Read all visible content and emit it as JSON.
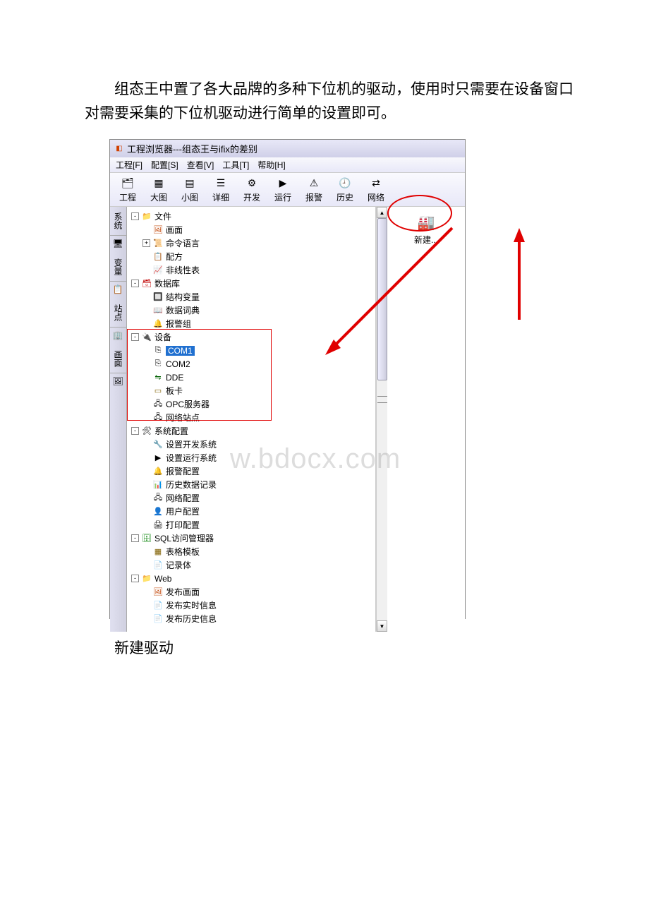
{
  "doc": {
    "intro": "组态王中置了各大品牌的多种下位机的驱动，使用时只需要在设备窗口对需要采集的下位机驱动进行简单的设置即可。",
    "caption": "新建驱动"
  },
  "window": {
    "title": "工程浏览器---组态王与ifix的差别"
  },
  "menu": {
    "project": "工程[F]",
    "config": "配置[S]",
    "view": "查看[V]",
    "tools": "工具[T]",
    "help": "帮助[H]"
  },
  "toolbar": {
    "project": "工程",
    "bigicon": "大图",
    "smallicon": "小图",
    "detail": "详细",
    "develop": "开发",
    "run": "运行",
    "alarm": "报警",
    "history": "历史",
    "network": "网络"
  },
  "vtabs": {
    "system": "系统",
    "variable": "变量",
    "site": "站点",
    "screen": "画面"
  },
  "tree": {
    "file": "文件",
    "screen": "画面",
    "cmdlang": "命令语言",
    "recipe": "配方",
    "nonlinear": "非线性表",
    "database": "数据库",
    "structvar": "结构变量",
    "datadict": "数据词典",
    "alarmgrp": "报警组",
    "device": "设备",
    "com1": "COM1",
    "com2": "COM2",
    "dde": "DDE",
    "board": "板卡",
    "opc": "OPC服务器",
    "netsite": "网络站点",
    "sysconfig": "系统配置",
    "devsys": "设置开发系统",
    "runsys": "设置运行系统",
    "alarmcfg": "报警配置",
    "histdata": "历史数据记录",
    "netcfg": "网络配置",
    "usercfg": "用户配置",
    "printcfg": "打印配置",
    "sqlmgr": "SQL访问管理器",
    "tabletpl": "表格模板",
    "recordbody": "记录体",
    "web": "Web",
    "pubscreen": "发布画面",
    "pubrt": "发布实时信息",
    "pubhist": "发布历史信息"
  },
  "rightpanel": {
    "new": "新建..."
  },
  "watermark": "w.bdocx.com"
}
